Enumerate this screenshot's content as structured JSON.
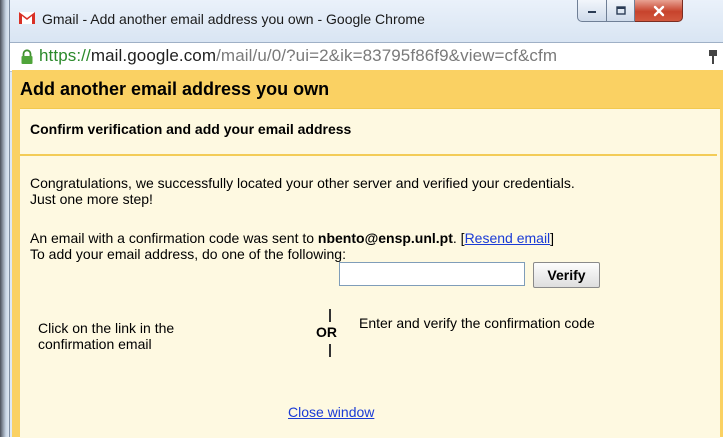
{
  "window": {
    "title": "Gmail - Add another email address you own - Google Chrome"
  },
  "address_bar": {
    "scheme": "https://",
    "host": "mail.google.com",
    "path": "/mail/u/0/?ui=2&ik=83795f86f9&view=cf&cfm"
  },
  "dialog": {
    "title": "Add another email address you own",
    "section_title": "Confirm verification and add your email address",
    "congrats_line1": "Congratulations, we successfully located your other server and verified your credentials.",
    "congrats_line2": "Just one more step!",
    "sent_prefix": "An email with a confirmation code was sent to",
    "email": "nbento@ensp.unl.pt",
    "sent_suffix": ".",
    "resend_open": "[",
    "resend_label": "Resend email",
    "resend_close": "]",
    "instruction": "To add your email address, do one of the following:",
    "option_link_line1": "Click on the link in the",
    "option_link_line2": "confirmation email",
    "or_label": "OR",
    "code_label": "Enter and verify the confirmation code",
    "code_value": "",
    "code_placeholder": "",
    "verify_label": "Verify",
    "close_label": "Close window"
  },
  "colors": {
    "dialog_header_bg": "#fad163",
    "dialog_body_bg": "#fef9e1",
    "link": "#1a3bd6",
    "https_green": "#2b8a2b"
  },
  "icons": [
    "gmail-logo-icon",
    "minimize-icon",
    "maximize-icon",
    "close-icon",
    "lock-icon",
    "page-icon"
  ]
}
